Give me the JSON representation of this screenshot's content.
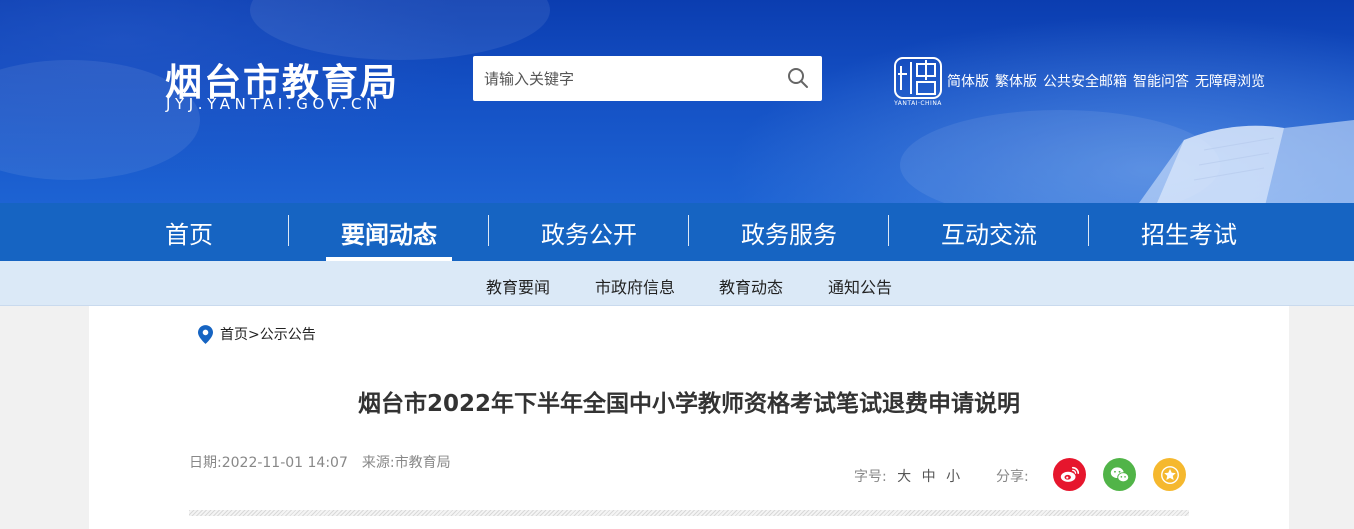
{
  "header": {
    "title": "烟台市教育局",
    "domain": "JYJ.YANTAI.GOV.CN",
    "search_placeholder": "请输入关键字",
    "emblem_caption": "YANTAI·CHINA",
    "links": [
      "简体版",
      "繁体版",
      "公共安全邮箱",
      "智能问答",
      "无障碍浏览"
    ]
  },
  "nav": {
    "items": [
      "首页",
      "要闻动态",
      "政务公开",
      "政务服务",
      "互动交流",
      "招生考试"
    ],
    "active": "要闻动态"
  },
  "subnav": {
    "items": [
      "教育要闻",
      "市政府信息",
      "教育动态",
      "通知公告"
    ]
  },
  "breadcrumb": {
    "home": "首页",
    "sep": ">",
    "current": "公示公告"
  },
  "article": {
    "title": "烟台市2022年下半年全国中小学教师资格考试笔试退费申请说明",
    "date": "日期:2022-11-01 14:07",
    "source": "来源:市教育局",
    "font_label": "字号:",
    "font_sizes": [
      "大",
      "中",
      "小"
    ],
    "share_label": "分享:"
  },
  "colors": {
    "nav_bg": "#1664c2",
    "subnav_bg": "#dbe9f7",
    "weibo": "#e6162d",
    "wechat": "#51b448",
    "favorite": "#f5b82e"
  },
  "icons": [
    "search-icon",
    "location-pin-icon",
    "weibo-icon",
    "wechat-icon",
    "star-icon"
  ]
}
